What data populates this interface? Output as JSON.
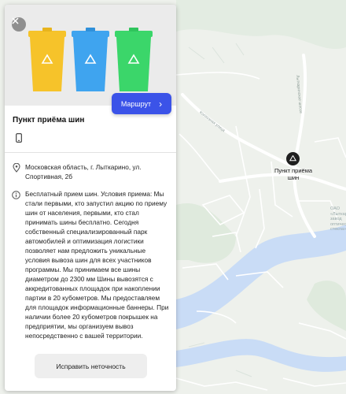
{
  "panel": {
    "title": "Пункт приёма шин",
    "route_label": "Маршрут",
    "address": "Московская область, г. Лыткарино, ул. Спортивная, 2б",
    "description": "Бесплатный прием шин. Условия приема: Мы стали первыми, кто запустил акцию по приему шин от населения, первыми, кто стал принимать шины бесплатно. Сегодня собственный специализированный парк автомобилей и оптимизация логистики позволяет нам предложить уникальные условия вывоза шин для всех участников программы. Мы принимаем все шины диаметром до 2300 мм Шины вывозятся с аккредитованных площадок при накоплении партии в 20 кубометров. Мы предоставляем для площадок информационные баннеры. При наличии более 20 кубометров покрышек на предприятии, мы организуем вывоз непосредственно с вашей территории.",
    "fix_label": "Исправить неточность"
  },
  "map": {
    "marker_label": "Пункт приёма шин",
    "streets": [
      "Лыткаринское шоссе",
      "Колхозная улица"
    ],
    "poi_label": "ОАО «Лыткарин завод оптическ стекла»"
  },
  "colors": {
    "accent": "#3b53e8",
    "bin_yellow": "#f6c32a",
    "bin_blue": "#3fa4ef",
    "bin_green": "#3bd66a",
    "water": "#c9dcf6",
    "road": "#ffffff"
  }
}
